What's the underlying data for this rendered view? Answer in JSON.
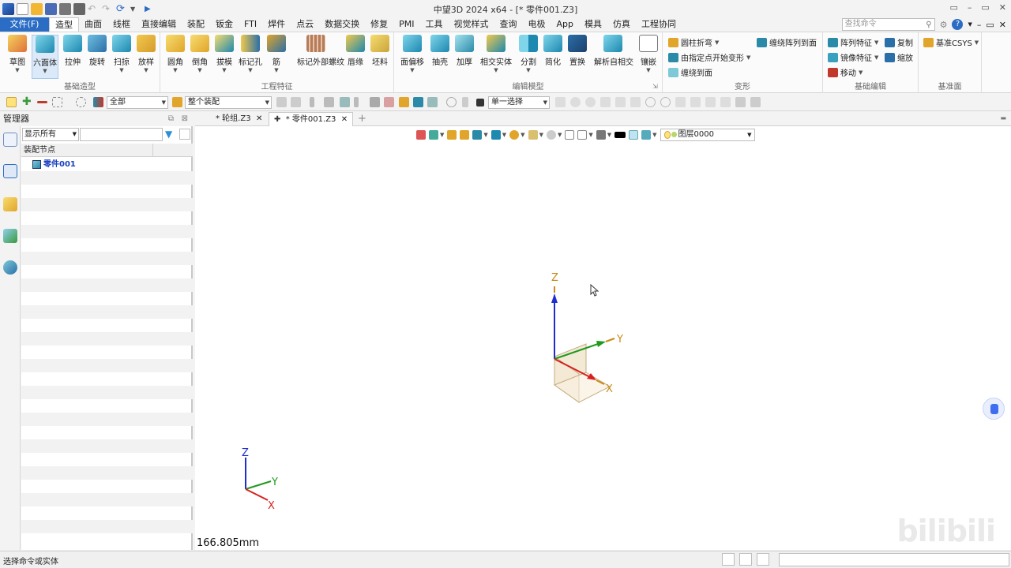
{
  "app": {
    "title": "中望3D 2024 x64 - [* 零件001.Z3]",
    "window_controls": [
      "▭",
      "–",
      "▭",
      "✕"
    ]
  },
  "quick_access": {
    "icons": [
      "app-logo-icon",
      "new-file-icon",
      "open-file-icon",
      "save-icon",
      "print-icon",
      "print-preview-icon",
      "undo-icon",
      "redo-icon",
      "regen-icon",
      "more-icon",
      "run-icon"
    ]
  },
  "menu": {
    "file": "文件(F)",
    "tabs": [
      "造型",
      "曲面",
      "线框",
      "直接编辑",
      "装配",
      "钣金",
      "FTI",
      "焊件",
      "点云",
      "数据交换",
      "修复",
      "PMI",
      "工具",
      "视觉样式",
      "查询",
      "电极",
      "App",
      "模具",
      "仿真",
      "工程协同"
    ],
    "active_tab": "造型",
    "search_placeholder": "查找命令",
    "help": "?"
  },
  "ribbon": {
    "groups": [
      {
        "label": "基础造型",
        "buttons": [
          "草图",
          "六面体",
          "拉伸",
          "旋转",
          "扫掠",
          "放样"
        ]
      },
      {
        "label": "工程特征",
        "buttons": [
          "圆角",
          "倒角",
          "拔模",
          "标记孔",
          "筋",
          "标记外部螺纹",
          "唇缘",
          "坯料"
        ]
      },
      {
        "label": "编辑模型",
        "buttons": [
          "面偏移",
          "抽壳",
          "加厚",
          "相交实体",
          "分割",
          "简化",
          "置换",
          "解析自相交",
          "镶嵌"
        ]
      },
      {
        "label": "变形",
        "rows": [
          "圆柱折弯",
          "由指定点开始变形",
          "缠绕到面",
          "缠绕阵列到面"
        ]
      },
      {
        "label": "基础编辑",
        "rows": [
          "阵列特征",
          "复制",
          "镜像特征",
          "缩放",
          "移动"
        ]
      },
      {
        "label": "基准面",
        "rows": [
          "基准CSYS"
        ]
      }
    ]
  },
  "toolbar2": {
    "filter_value": "全部",
    "assembly_value": "整个装配",
    "select_mode": "单一选择"
  },
  "manager": {
    "title": "管理器",
    "filter_select": "显示所有",
    "tree_header": "装配节点",
    "node": "零件001"
  },
  "doc_tabs": [
    {
      "label": "* 轮组.Z3",
      "active": false
    },
    {
      "label": "* 零件001.Z3",
      "active": true
    }
  ],
  "viewport": {
    "layer": "图层0000",
    "scale_readout": "166.805mm",
    "axes_center": {
      "x": "X",
      "y": "Y",
      "z": "Z"
    },
    "axes_corner": {
      "x": "X",
      "y": "Y",
      "z": "Z"
    },
    "watermark": "bilibili"
  },
  "status": {
    "text": "选择命令或实体"
  },
  "colors": {
    "accent_blue": "#2b6cc4",
    "axis_x": "#d62020",
    "axis_y": "#1f9a1f",
    "axis_z": "#1f2fcf",
    "axis_label": "#c88a18"
  }
}
